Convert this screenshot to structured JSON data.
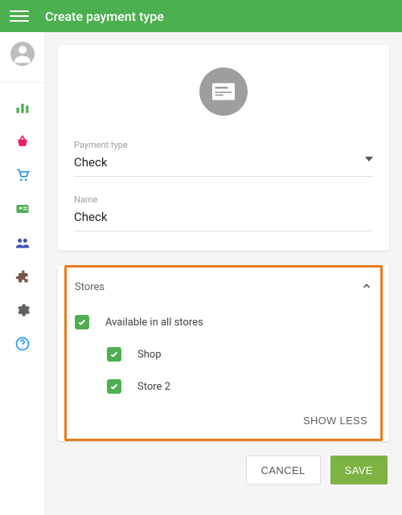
{
  "header": {
    "title": "Create payment type"
  },
  "form": {
    "payment_type_label": "Payment type",
    "payment_type_value": "Check",
    "name_label": "Name",
    "name_value": "Check"
  },
  "stores": {
    "section_label": "Stores",
    "all_label": "Available in all stores",
    "items": [
      {
        "label": "Shop"
      },
      {
        "label": "Store 2"
      }
    ],
    "show_less": "SHOW LESS"
  },
  "footer": {
    "cancel": "CANCEL",
    "save": "SAVE"
  }
}
